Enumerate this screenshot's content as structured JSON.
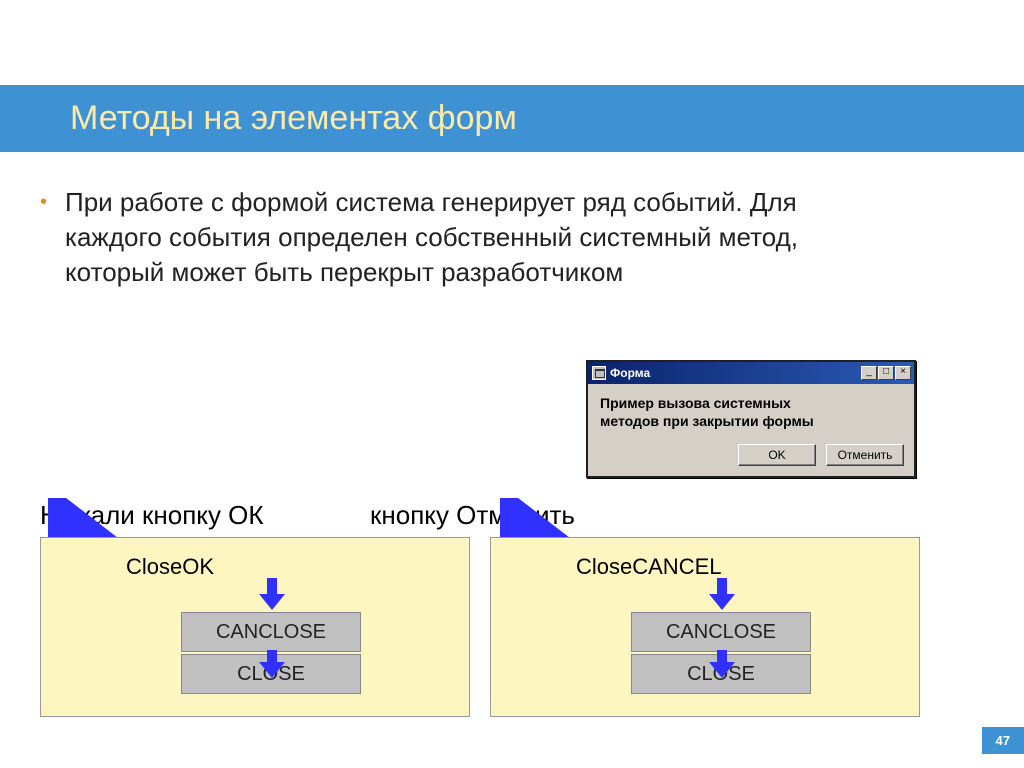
{
  "slide": {
    "title": "Методы на элементах форм",
    "bullet": "При работе с формой система генерирует ряд событий. Для каждого события определен собственный системный метод, который может быть перекрыт разработчиком",
    "page_number": "47"
  },
  "dialog": {
    "title": "Форма",
    "message_line1": "Пример вызова системных",
    "message_line2": "методов при закрытии формы",
    "ok_label": "OK",
    "cancel_label": "Отменить",
    "min_symbol": "_",
    "max_symbol": "□",
    "close_symbol": "×"
  },
  "labels": {
    "pressed_ok": "Нажали кнопку ОК",
    "pressed_cancel": "кнопку Отменить"
  },
  "flow_ok": {
    "entry": "CloseOK",
    "step1": "CANCLOSE",
    "step2": "CLOSE"
  },
  "flow_cancel": {
    "entry": "CloseCANCEL",
    "step1": "CANCLOSE",
    "step2": "CLOSE"
  },
  "colors": {
    "accent": "#3e92d4",
    "title_text": "#ffe9a8",
    "panel": "#fdf6c0",
    "arrow": "#3030ff"
  }
}
